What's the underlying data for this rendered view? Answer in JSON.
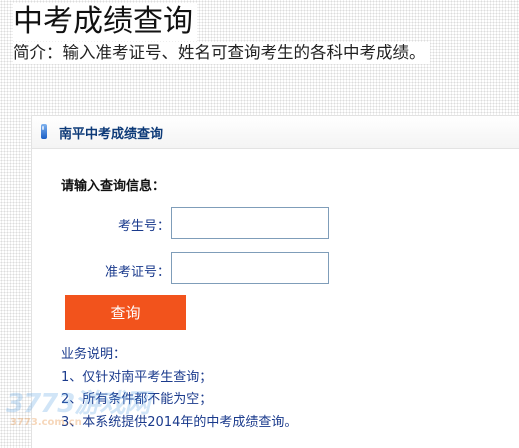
{
  "page": {
    "title": "中考成绩查询",
    "intro": "简介：输入准考证号、姓名可查询考生的各科中考成绩。"
  },
  "panel": {
    "title": "南平中考成绩查询",
    "section_title": "请输入查询信息：",
    "fields": [
      {
        "label": "考生号：",
        "value": ""
      },
      {
        "label": "准考证号：",
        "value": ""
      }
    ],
    "query_button": "查询",
    "notes": {
      "heading": "业务说明：",
      "items": [
        "1、仅针对南平考生查询；",
        "2、所有条件都不能为空；",
        "3、本系统提供2014年的中考成绩查询。"
      ]
    }
  },
  "watermark": {
    "main": "3773游戏网",
    "sub": "3773.com.cn"
  },
  "colors": {
    "button": "#f2531c",
    "label_text": "#1a3a8c",
    "panel_title": "#0d3a78",
    "input_border": "#7f9db9"
  },
  "icons": {
    "panel_header": "blue-bar-icon"
  }
}
